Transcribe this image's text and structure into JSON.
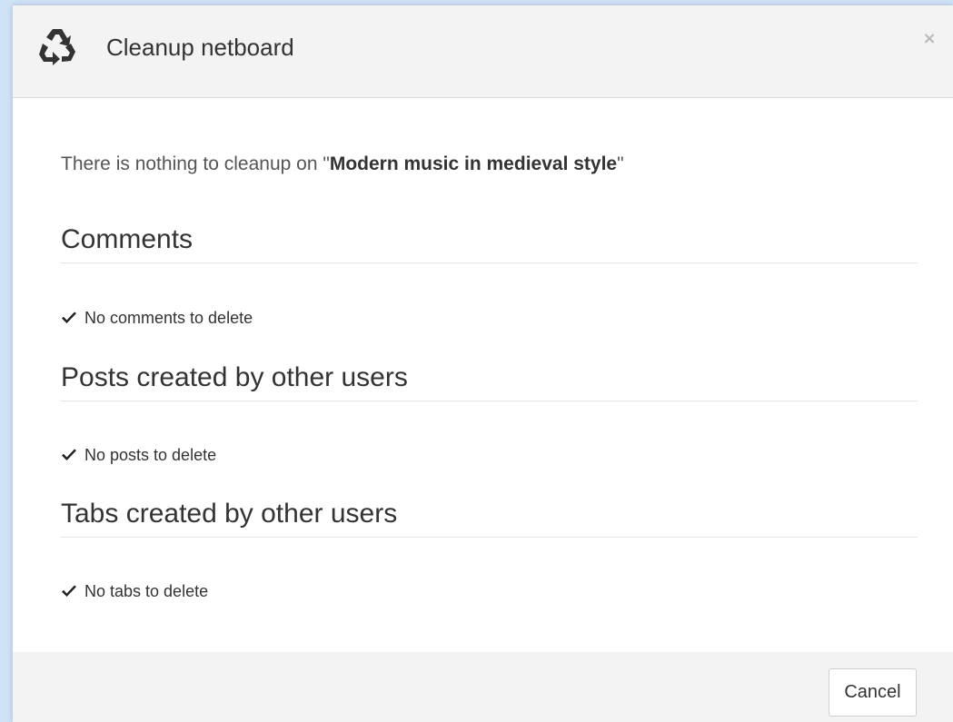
{
  "dialog": {
    "title": "Cleanup netboard",
    "header_icon": "recycle-icon",
    "close_label": "×",
    "intro_prefix": "There is nothing to cleanup on \"",
    "board_name": "Modern music in medieval style",
    "intro_suffix": "\"",
    "sections": [
      {
        "title": "Comments",
        "status": "No comments to delete",
        "status_icon": "check-icon"
      },
      {
        "title": "Posts created by other users",
        "status": "No posts to delete",
        "status_icon": "check-icon"
      },
      {
        "title": "Tabs created by other users",
        "status": "No tabs to delete",
        "status_icon": "check-icon"
      }
    ],
    "cancel_label": "Cancel"
  },
  "colors": {
    "backdrop": "#cfe2f7",
    "header_bg": "#f3f3f3",
    "text": "#333333",
    "muted_text": "#555555",
    "close_icon": "#b9b9b9"
  }
}
